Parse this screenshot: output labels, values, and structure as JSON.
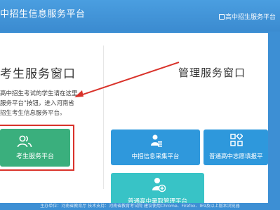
{
  "header": {
    "title": "中招生信息服务平台",
    "right_link": "高中招生服务平台"
  },
  "left": {
    "title": "考生服务窗口",
    "desc": [
      "高中招生考试的学生请在这里",
      "服务平台\"按钮，进入河南省",
      "招生考生信息服务平台。"
    ],
    "student_button": "考生服务平台"
  },
  "right": {
    "title": "管理服务窗口",
    "tiles": {
      "collect": "中招信息采集平台",
      "volunteer": "普通高中志愿填报平",
      "admit": "普通高中录取管理平台"
    }
  },
  "footer": {
    "text": "主办单位：河南省教育厅  技术支持：河南省教育考试院  建议使用Chrome、Firefox、IE9及以上版本浏览器"
  },
  "colors": {
    "background": "#3d8fd4",
    "student_button": "#3aaf7d",
    "tile_blue": "#2f98dc",
    "tile_cyan": "#38c3c6",
    "highlight": "#d9322a"
  }
}
